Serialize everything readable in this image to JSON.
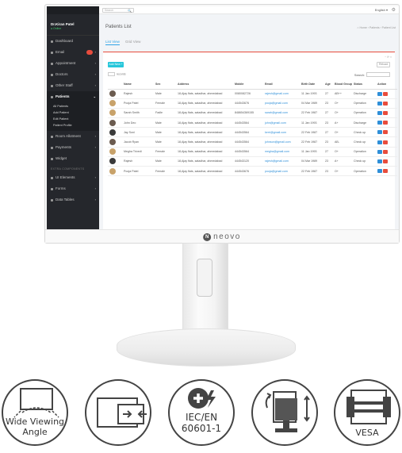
{
  "screen": {
    "sidebar": {
      "user_name": "Dr.Kiran Patel",
      "user_status": "● Online",
      "items": [
        {
          "label": "Dashboard"
        },
        {
          "label": "Email"
        },
        {
          "label": "Appointment"
        },
        {
          "label": "Doctors"
        },
        {
          "label": "Other Staff"
        },
        {
          "label": "Patients"
        }
      ],
      "sub_items": [
        "All Patients",
        "Add Patient",
        "Edit Patient",
        "Patient Profile"
      ],
      "items_after": [
        {
          "label": "Room Allotment"
        },
        {
          "label": "Payments"
        },
        {
          "label": "Widget"
        }
      ],
      "section_label": "EXTRA COMPONENTS",
      "items_extra": [
        {
          "label": "UI Elements"
        },
        {
          "label": "Forms"
        },
        {
          "label": "Data Tables"
        }
      ]
    },
    "topbar": {
      "search_placeholder": "Search",
      "search_icon": "🔍",
      "language": "English ▾",
      "settings_icon": "⚙"
    },
    "page_title": "Patients List",
    "breadcrumb": "⌂ Home  ›  Patients  ›  Patient List",
    "tabs": [
      "List View",
      "Grid View"
    ],
    "card_tools": "− ⟳ ×",
    "add_button": "Add New +",
    "refresh_button": "Reload",
    "records_label": "records",
    "search_label": "Search:",
    "table": {
      "columns": [
        "",
        "Name",
        "Sex",
        "Address",
        "Mobile",
        "Email",
        "Birth Date",
        "Age",
        "Blood Group",
        "Status",
        "Action"
      ],
      "rows": [
        {
          "name": "Rajesh",
          "sex": "Male",
          "address": "18,Ajay flats, satadhar, ahmedabad",
          "mobile": "0080082726",
          "email": "rajesh@gmail.com",
          "birth": "11 Jan 1993",
          "age": "27",
          "blood": "AB++",
          "status": "Discharge",
          "avatar": "m"
        },
        {
          "name": "Pooja Patel",
          "sex": "Female",
          "address": "18,Ajay flats, satadhar, ahmedabad",
          "mobile": "444543676",
          "email": "pooja@gmail.com",
          "birth": "04 Mar 1989",
          "age": "23",
          "blood": "O+",
          "status": "Operation",
          "avatar": "f"
        },
        {
          "name": "Sarah Smith",
          "sex": "Fadle",
          "address": "18,Ajay flats, satadhar, ahmedabad",
          "mobile": "848654369155",
          "email": "sarah@gmail.com",
          "birth": "22 Feb 1987",
          "age": "27",
          "blood": "O+",
          "status": "Operation",
          "avatar": "f"
        },
        {
          "name": "John Deo",
          "sex": "Male",
          "address": "18,Ajay flats, satadhar, ahmedabad",
          "mobile": "444543564",
          "email": "john@gmail.com",
          "birth": "11 Jan 1993",
          "age": "23",
          "blood": "A+",
          "status": "Discharge",
          "avatar": "m"
        },
        {
          "name": "Jay Soni",
          "sex": "Male",
          "address": "18,Ajay flats, satadhar, ahmedabad",
          "mobile": "444543564",
          "email": "kerri@gmail.com",
          "birth": "22 Feb 1987",
          "age": "27",
          "blood": "O+",
          "status": "Check up",
          "avatar": "m2"
        },
        {
          "name": "Jacob Ryan",
          "sex": "Male",
          "address": "18,Ajay flats, satadhar, ahmedabad",
          "mobile": "444543564",
          "email": "johnson@gmail.com",
          "birth": "22 Feb 1987",
          "age": "23",
          "blood": "AB-",
          "status": "Check up",
          "avatar": "m"
        },
        {
          "name": "Megha Trivedi",
          "sex": "Female",
          "address": "18,Ajay flats, satadhar, ahmedabad",
          "mobile": "444543564",
          "email": "megha@gmail.com",
          "birth": "11 Jan 1993",
          "age": "27",
          "blood": "O+",
          "status": "Operation",
          "avatar": "f"
        },
        {
          "name": "Rajesh",
          "sex": "Male",
          "address": "18,Ajay flats, satadhar, ahmedabad",
          "mobile": "444543120",
          "email": "rajesh@gmail.com",
          "birth": "04 Mar 1989",
          "age": "23",
          "blood": "A+",
          "status": "Check up",
          "avatar": "m2"
        },
        {
          "name": "Pooja Patel",
          "sex": "Female",
          "address": "18,Ajay flats, satadhar, ahmedabad",
          "mobile": "444543676",
          "email": "pooja@gmail.com",
          "birth": "22 Feb 1987",
          "age": "23",
          "blood": "O+",
          "status": "Operation",
          "avatar": "f"
        }
      ]
    }
  },
  "brand": {
    "mark": "N",
    "name": "neovo"
  },
  "features": [
    {
      "icon": "wide-viewing-angle-icon",
      "label_line1": "Wide Viewing",
      "label_line2": "Angle"
    },
    {
      "icon": "thin-bezel-icon"
    },
    {
      "icon": "medical-standard-icon",
      "label_line1": "IEC/EN",
      "label_line2": "60601-1"
    },
    {
      "icon": "height-adjust-swivel-icon"
    },
    {
      "icon": "vesa-mount-icon",
      "label_line1": "VESA"
    }
  ],
  "colors": {
    "accent": "#2fa4e7",
    "danger": "#e84c3d",
    "sidebar": "#25272c",
    "add_button": "#26c6da"
  }
}
